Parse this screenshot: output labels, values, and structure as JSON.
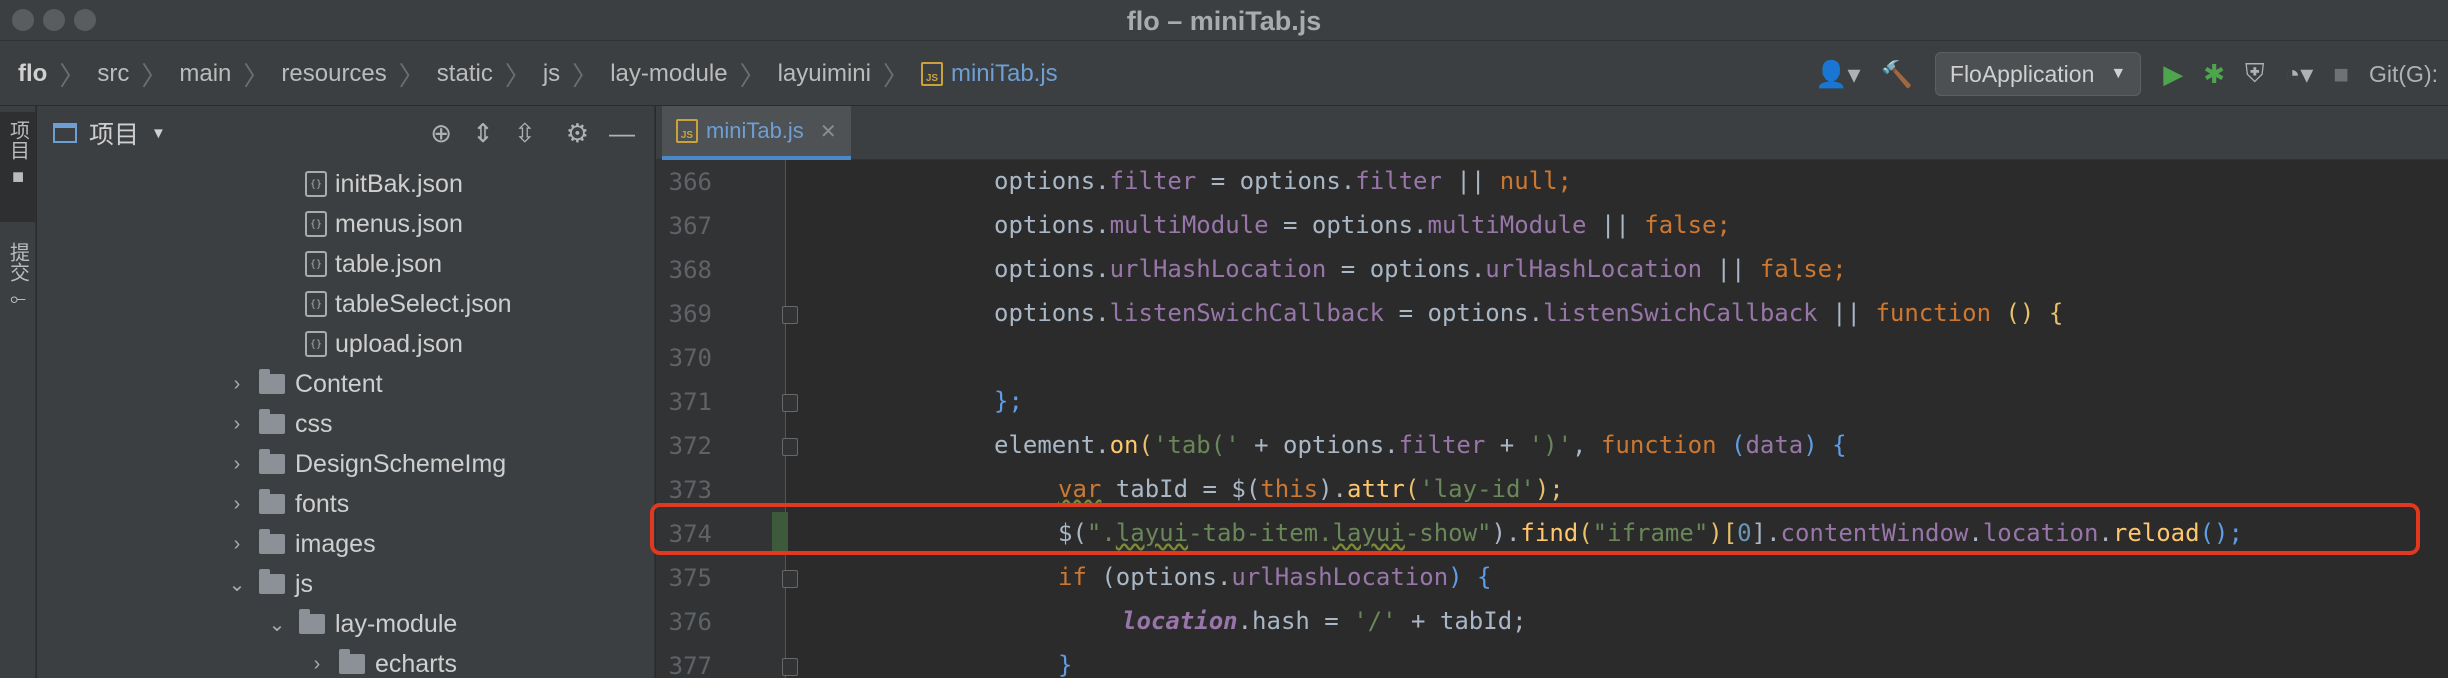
{
  "window": {
    "title": "flo – miniTab.js"
  },
  "breadcrumbs": [
    {
      "label": "flo",
      "bold": true
    },
    {
      "label": "src"
    },
    {
      "label": "main"
    },
    {
      "label": "resources"
    },
    {
      "label": "static"
    },
    {
      "label": "js"
    },
    {
      "label": "lay-module"
    },
    {
      "label": "layuimini"
    },
    {
      "label": "miniTab.js",
      "file": true
    }
  ],
  "toolbar": {
    "run_config": "FloApplication",
    "git_label": "Git(G):",
    "js_badge": "JS"
  },
  "left_strip": {
    "project_label": "项目",
    "commit_label": "提交"
  },
  "project_panel": {
    "title": "项目",
    "tree": [
      {
        "label": "initBak.json",
        "type": "json"
      },
      {
        "label": "menus.json",
        "type": "json"
      },
      {
        "label": "table.json",
        "type": "json"
      },
      {
        "label": "tableSelect.json",
        "type": "json"
      },
      {
        "label": "upload.json",
        "type": "json"
      },
      {
        "label": "Content",
        "type": "folder",
        "expanded": false
      },
      {
        "label": "css",
        "type": "folder",
        "expanded": false
      },
      {
        "label": "DesignSchemeImg",
        "type": "folder",
        "expanded": false
      },
      {
        "label": "fonts",
        "type": "folder",
        "expanded": false
      },
      {
        "label": "images",
        "type": "folder",
        "expanded": false
      },
      {
        "label": "js",
        "type": "folder",
        "expanded": true
      },
      {
        "label": "lay-module",
        "type": "folder",
        "expanded": true
      },
      {
        "label": "echarts",
        "type": "folder",
        "expanded": false
      }
    ]
  },
  "editor": {
    "tab_label": "miniTab.js",
    "lines": [
      {
        "num": "366"
      },
      {
        "num": "367"
      },
      {
        "num": "368"
      },
      {
        "num": "369"
      },
      {
        "num": "370"
      },
      {
        "num": "371"
      },
      {
        "num": "372"
      },
      {
        "num": "373"
      },
      {
        "num": "374",
        "highlighted": true
      },
      {
        "num": "375"
      },
      {
        "num": "376"
      },
      {
        "num": "377"
      }
    ],
    "code": {
      "l366": {
        "obj": "options.",
        "prop": "filter",
        "mid": " = options.",
        "prop2": "filter",
        "op": " || ",
        "val": "null",
        "end": ";"
      },
      "l367": {
        "obj": "options.",
        "prop": "multiModule",
        "mid": " = options.",
        "prop2": "multiModule",
        "op": " || ",
        "val": "false",
        "end": ";"
      },
      "l368": {
        "obj": "options.",
        "prop": "urlHashLocation",
        "mid": " = options.",
        "prop2": "urlHashLocation",
        "op": " || ",
        "val": "false",
        "end": ";"
      },
      "l369": {
        "obj": "options.",
        "prop": "listenSwichCallback",
        "mid": " = options.",
        "prop2": "listenSwichCallback",
        "op": " || ",
        "kw": "function",
        "rest": " () {"
      },
      "l371": {
        "text": "};"
      },
      "l372": {
        "a": "element.",
        "fn": "on",
        "p1": "(",
        "s1": "'tab('",
        "b": " + options.",
        "prop": "filter",
        "c": " + ",
        "s2": "')'",
        "d": ", ",
        "kw": "function",
        "e": " (",
        "arg": "data",
        "f": ") {"
      },
      "l373": {
        "kw": "var",
        "a": " tabId = $(",
        "this": "this",
        "b": ").",
        "fn": "attr",
        "c": "(",
        "s": "'lay-id'",
        "d": ");"
      },
      "l374": {
        "a": "$(",
        "s1": "\".",
        "u1": "layui",
        "s2": "-tab-item.",
        "u2": "layui",
        "s3": "-show\"",
        "b": ").",
        "fn": "find",
        "c": "(",
        "s4": "\"iframe\"",
        "d": ")[",
        "num": "0",
        "e": "].",
        "p1": "contentWindow",
        "f": ".",
        "p2": "location",
        "g": ".",
        "fn2": "reload",
        "h": "();"
      },
      "l375": {
        "kw": "if",
        "a": " (options.",
        "prop": "urlHashLocation",
        "b": ") {"
      },
      "l376": {
        "glob": "location",
        "a": ".hash = ",
        "s": "'/'",
        "b": " + tabId;"
      },
      "l377": {
        "text": "}"
      }
    }
  }
}
